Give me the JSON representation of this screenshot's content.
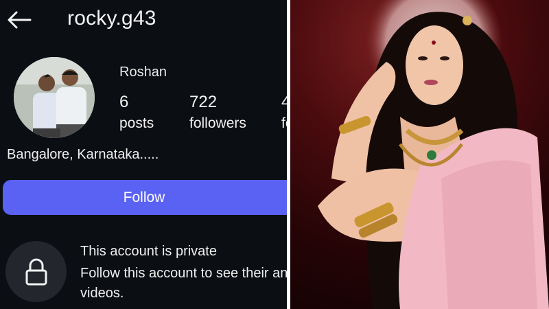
{
  "profile": {
    "username": "rocky.g43",
    "display_name": "Roshan",
    "bio": "Bangalore,  Karnataka.....",
    "stats": [
      {
        "value": "6",
        "label": "posts"
      },
      {
        "value": "722",
        "label": "followers"
      },
      {
        "value": "4",
        "label": "fo"
      }
    ],
    "follow_label": "Follow",
    "private_title": "This account is private",
    "private_desc": "Follow this account to see their and videos."
  },
  "icons": {
    "back": "back-arrow-icon",
    "lock": "lock-icon"
  },
  "colors": {
    "background": "#0b0e13",
    "follow_button": "#5a62f3",
    "lock_circle": "#23272d",
    "divider": "#ffffff"
  }
}
